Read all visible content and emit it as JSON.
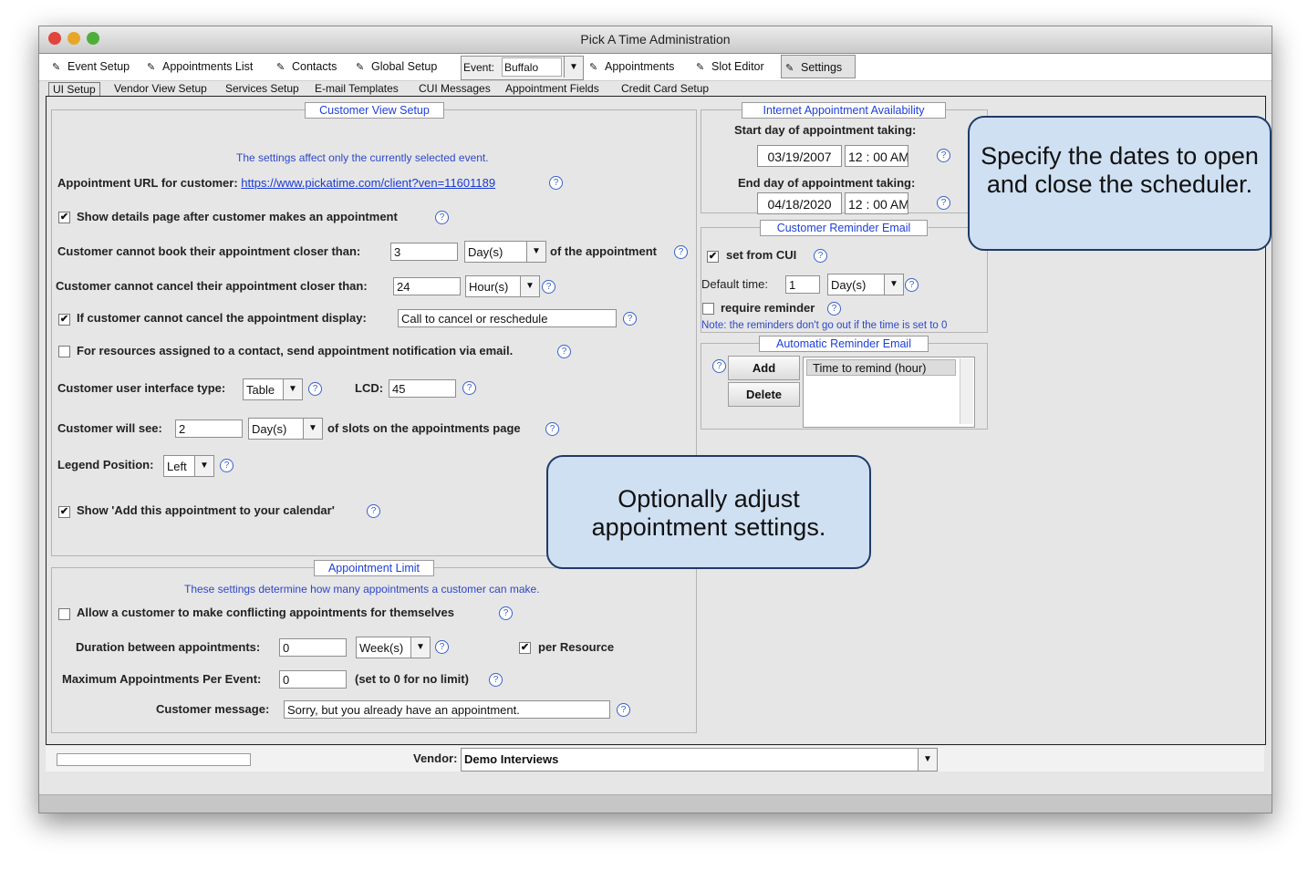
{
  "window": {
    "title": "Pick A Time Administration"
  },
  "toolbar": {
    "event_setup": "Event Setup",
    "appointments_list": "Appointments List",
    "contacts": "Contacts",
    "global_setup": "Global Setup",
    "event_label": "Event:",
    "event_value": "Buffalo",
    "appointments": "Appointments",
    "slot_editor": "Slot Editor",
    "settings": "Settings"
  },
  "tabs": [
    "UI Setup",
    "Vendor View Setup",
    "Services Setup",
    "E-mail Templates",
    "CUI Messages",
    "Appointment Fields",
    "Credit Card Setup"
  ],
  "customer_view": {
    "legend": "Customer View Setup",
    "note": "The settings affect only the currently selected event.",
    "url_label": "Appointment URL for customer:",
    "url": "https://www.pickatime.com/client?ven=11601189",
    "show_details": "Show details page after customer makes an appointment",
    "book_label": "Customer cannot book their appointment closer than:",
    "book_value": "3",
    "book_unit": "Day(s)",
    "book_suffix": "of the appointment",
    "cancel_label": "Customer cannot cancel their appointment closer than:",
    "cancel_value": "24",
    "cancel_unit": "Hour(s)",
    "cancel_display_label": "If customer cannot cancel the appointment display:",
    "cancel_display_value": "Call to cancel or reschedule",
    "resources_label": "For resources assigned to a contact, send appointment notification via email.",
    "ui_type_label": "Customer user interface type:",
    "ui_type_value": "Table",
    "lcd_label": "LCD:",
    "lcd_value": "45",
    "will_see_label": "Customer will see:",
    "will_see_value": "2",
    "will_see_unit": "Day(s)",
    "will_see_suffix": "of slots on the appointments page",
    "legend_pos_label": "Legend Position:",
    "legend_pos_value": "Left",
    "add_calendar": "Show 'Add this appointment to your calendar'"
  },
  "limit": {
    "legend": "Appointment Limit",
    "note": "These settings determine how many appointments a customer can make.",
    "conflict_label": "Allow a customer to make conflicting appointments for themselves",
    "duration_label": "Duration between appointments:",
    "duration_value": "0",
    "duration_unit": "Week(s)",
    "per_resource": "per Resource",
    "max_label": "Maximum Appointments Per Event:",
    "max_value": "0",
    "max_hint": "(set to 0 for no limit)",
    "message_label": "Customer message:",
    "message_value": "Sorry, but you already have an appointment."
  },
  "availability": {
    "legend": "Internet Appointment Availability",
    "start_label": "Start day of appointment taking:",
    "start_date": "03/19/2007",
    "start_time": "12 : 00 AM",
    "end_label": "End day of appointment taking:",
    "end_date": "04/18/2020",
    "end_time": "12 : 00 AM"
  },
  "reminder": {
    "legend": "Customer Reminder Email",
    "set_from_cui": "set from CUI",
    "default_time_label": "Default time:",
    "default_time_value": "1",
    "default_time_unit": "Day(s)",
    "require": "require reminder",
    "note": "Note: the reminders don't go out if the time is set to 0"
  },
  "auto_reminder": {
    "legend": "Automatic Reminder Email",
    "add": "Add",
    "delete": "Delete",
    "column": "Time to remind (hour)"
  },
  "footer": {
    "vendor_label": "Vendor:",
    "vendor_value": "Demo Interviews"
  },
  "callouts": {
    "dates": "Specify the dates to open and close the scheduler.",
    "settings": "Optionally adjust appointment settings."
  },
  "icons": {
    "help": "?",
    "check": "✔",
    "arrow": "▼",
    "toolbar_icon": "✎"
  },
  "colors": {
    "legend_text": "#1d3fd8",
    "callout_bg": "#cfe0f2",
    "callout_border": "#1f3a68"
  }
}
